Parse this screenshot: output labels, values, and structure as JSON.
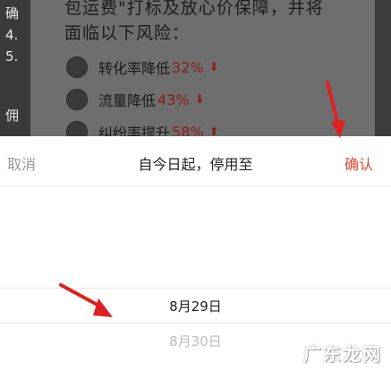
{
  "background": {
    "left_fragments": [
      "确",
      "4.",
      "5.",
      "佣"
    ],
    "dialog_lines": [
      "包运费\"打标及放心价保障，并将",
      "面临以下风险："
    ],
    "risks": [
      {
        "label": "转化率降低",
        "value": "32%",
        "arrow": "⬇",
        "icon": "chart-icon"
      },
      {
        "label": "流量降低",
        "value": "43%",
        "arrow": "⬇",
        "icon": "moneybag-icon"
      },
      {
        "label": "纠纷率提升",
        "value": "58%",
        "arrow": "⬆",
        "icon": "shield-icon"
      }
    ]
  },
  "sheet": {
    "cancel_label": "取消",
    "title": "自今日起，停用至",
    "confirm_label": "确认",
    "options": {
      "selected": "8月29日",
      "next": "8月30日"
    }
  },
  "watermark": "广东龙网",
  "colors": {
    "confirm": "#e0452c",
    "highlight_value": "#8a1d1d",
    "arrow": "#e02020"
  }
}
